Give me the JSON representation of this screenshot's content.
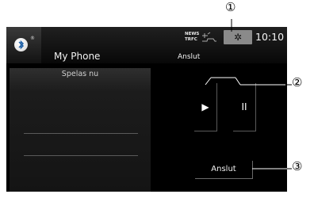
{
  "status_bar": {
    "phone_name": "My Phone",
    "connection_status": "Anslut",
    "news_label": "NEWS",
    "traffic_label": "TRFC",
    "clock": "10:10",
    "bluetooth_registered_mark": "®"
  },
  "panel": {
    "title": "Spelas nu"
  },
  "controls": {
    "play_symbol": "▶",
    "pause_symbol": "II",
    "connect_label": "Anslut"
  },
  "settings_symbol": "✲",
  "callouts": [
    "①",
    "②",
    "③"
  ]
}
